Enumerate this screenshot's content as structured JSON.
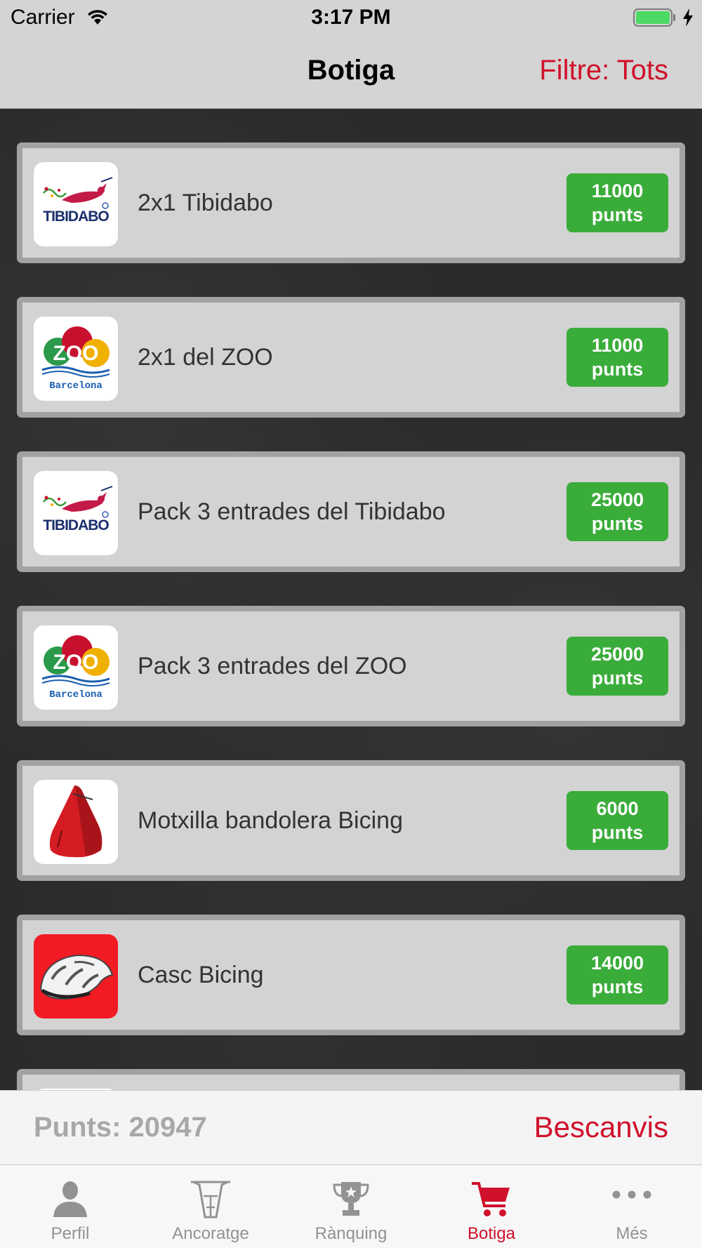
{
  "status_bar": {
    "carrier": "Carrier",
    "time": "3:17 PM"
  },
  "nav": {
    "title": "Botiga",
    "filter": "Filtre: Tots"
  },
  "products": [
    {
      "name": "2x1 Tibidabo",
      "price": "11000",
      "unit": "punts",
      "logo": "tibidabo-logo"
    },
    {
      "name": "2x1 del ZOO",
      "price": "11000",
      "unit": "punts",
      "logo": "zoo-barcelona-logo"
    },
    {
      "name": "Pack 3 entrades del Tibidabo",
      "price": "25000",
      "unit": "punts",
      "logo": "tibidabo-logo"
    },
    {
      "name": "Pack 3 entrades del ZOO",
      "price": "25000",
      "unit": "punts",
      "logo": "zoo-barcelona-logo"
    },
    {
      "name": "Motxilla bandolera Bicing",
      "price": "6000",
      "unit": "punts",
      "logo": "red-backpack-image"
    },
    {
      "name": "Casc Bicing",
      "price": "14000",
      "unit": "punts",
      "logo": "bike-helmet-image"
    }
  ],
  "logo_text": {
    "tibidabo": "TIBIDABO",
    "zoo_word": "ZOO",
    "zoo_city": "Barcelona"
  },
  "points": {
    "label": "Punts: 20947",
    "exchange": "Bescanvis"
  },
  "tabs": [
    {
      "label": "Perfil",
      "icon": "person-icon",
      "active": false
    },
    {
      "label": "Ancoratge",
      "icon": "bike-dock-icon",
      "active": false
    },
    {
      "label": "Rànquing",
      "icon": "trophy-icon",
      "active": false
    },
    {
      "label": "Botiga",
      "icon": "cart-icon",
      "active": true
    },
    {
      "label": "Més",
      "icon": "more-icon",
      "active": false
    }
  ],
  "colors": {
    "accent_red": "#d0112b",
    "price_green": "#3aac3a",
    "tab_inactive": "#929292"
  }
}
